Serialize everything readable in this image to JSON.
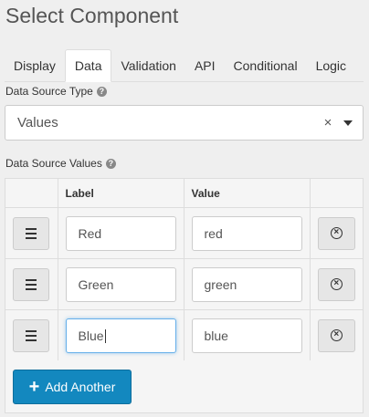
{
  "title": "Select Component",
  "tabs": [
    {
      "label": "Display",
      "active": false
    },
    {
      "label": "Data",
      "active": true
    },
    {
      "label": "Validation",
      "active": false
    },
    {
      "label": "API",
      "active": false
    },
    {
      "label": "Conditional",
      "active": false
    },
    {
      "label": "Logic",
      "active": false
    }
  ],
  "data_source_type": {
    "label": "Data Source Type",
    "value": "Values",
    "clear_glyph": "×",
    "help_glyph": "?"
  },
  "data_source_values": {
    "label": "Data Source Values",
    "help_glyph": "?",
    "columns": [
      "",
      "Label",
      "Value",
      ""
    ],
    "rows": [
      {
        "label": "Red",
        "value": "red"
      },
      {
        "label": "Green",
        "value": "green"
      },
      {
        "label": "Blue",
        "value": "blue"
      }
    ],
    "remove_glyph": "×",
    "add_button": "Add Another",
    "add_glyph": "+"
  },
  "colors": {
    "accent": "#1388bf",
    "focus": "#66afe9"
  },
  "icons": {
    "handle": "drag-handle-icon",
    "remove": "remove-circle-icon",
    "help": "help-icon",
    "add": "plus-icon",
    "dropdown": "caret-down-icon"
  }
}
